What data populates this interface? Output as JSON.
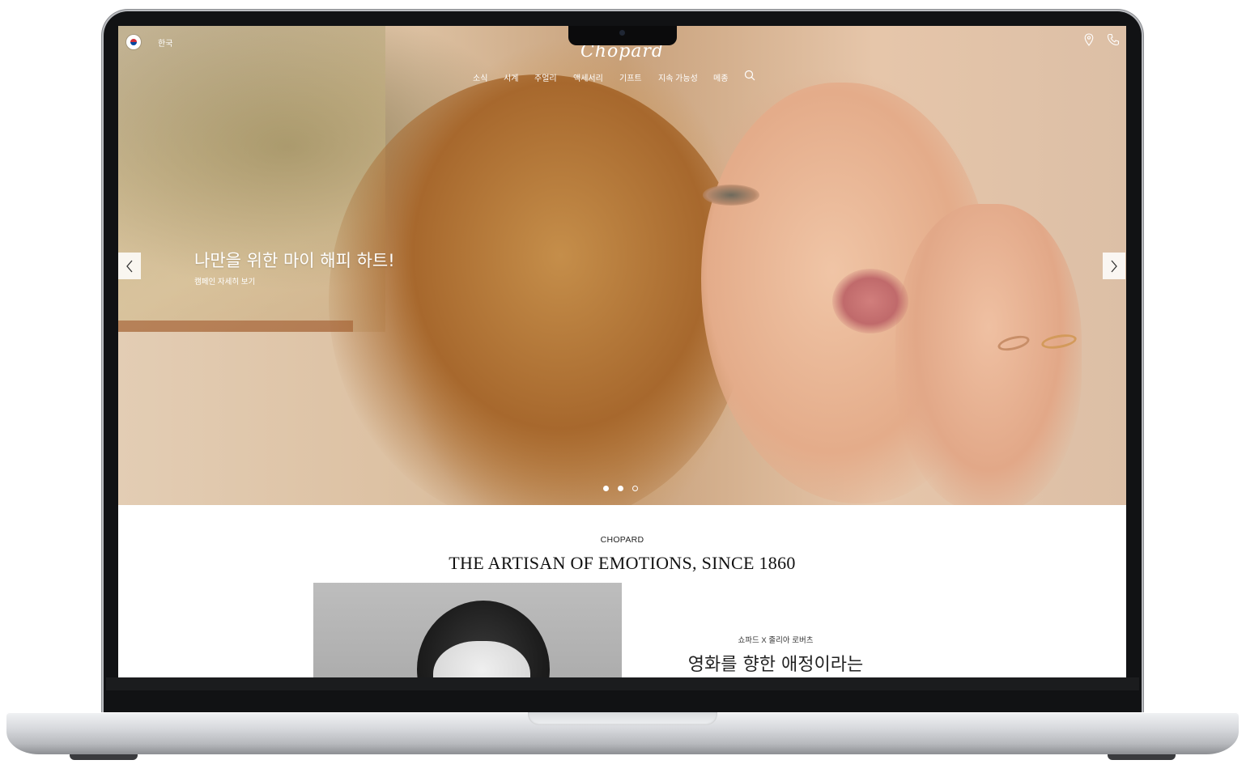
{
  "header": {
    "language": "한국",
    "logo": "Chopard",
    "nav": [
      "소식",
      "시계",
      "주얼리",
      "액세서리",
      "기프트",
      "지속 가능성",
      "메종"
    ]
  },
  "icons": {
    "flag": "south-korea-flag-icon",
    "search": "search-icon",
    "location": "location-pin-icon",
    "phone": "phone-icon",
    "prev": "chevron-left-icon",
    "next": "chevron-right-icon"
  },
  "hero": {
    "headline": "나만을 위한 마이 해피 하트!",
    "cta": "캠페인 자세히 보기",
    "slides": [
      {
        "state": "filled"
      },
      {
        "state": "filled"
      },
      {
        "state": "outline"
      }
    ]
  },
  "section": {
    "kicker": "CHOPARD",
    "title": "THE ARTISAN OF EMOTIONS, SINCE 1860"
  },
  "feature": {
    "kicker": "쇼파드 X 줄리아 로버츠",
    "title": "영화를 향한 애정이라는"
  },
  "colors": {
    "text_on_hero": "#ffffff",
    "laptop_bezel": "#111214",
    "laptop_body": "#c9cbcf"
  }
}
